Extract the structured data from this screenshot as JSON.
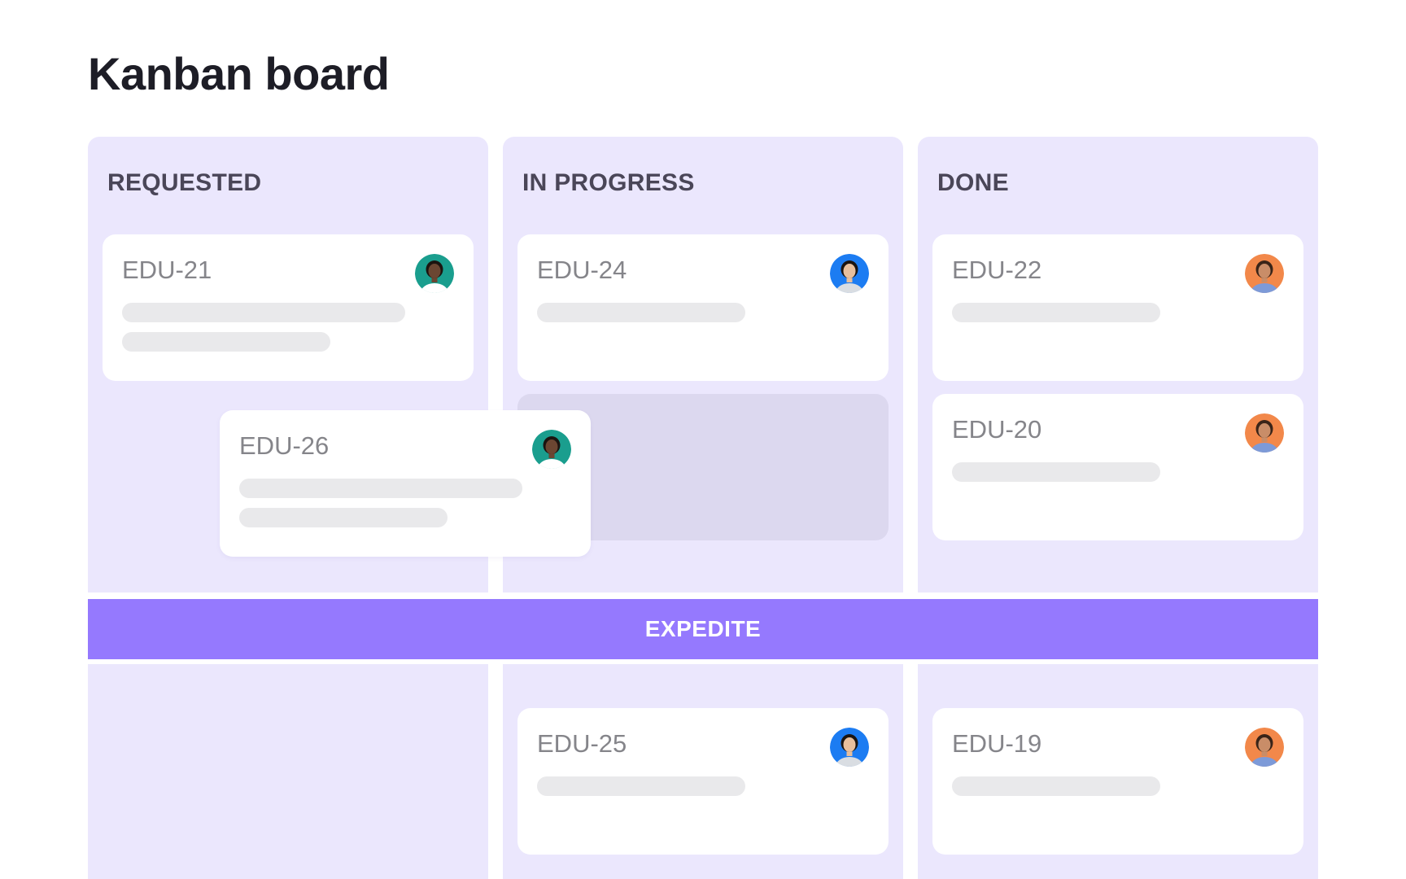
{
  "page": {
    "title": "Kanban board"
  },
  "columns": [
    {
      "id": "requested",
      "label": "REQUESTED"
    },
    {
      "id": "in_progress",
      "label": "IN PROGRESS"
    },
    {
      "id": "done",
      "label": "DONE"
    }
  ],
  "swimlane": {
    "label": "EXPEDITE"
  },
  "avatars": {
    "teal": {
      "bg": "#1a9e8e",
      "skin": "#6b4632",
      "hair": "#1b1410",
      "shirt": "#ffffff"
    },
    "blue": {
      "bg": "#1c7cf2",
      "skin": "#e7bf9d",
      "hair": "#1b1410",
      "shirt": "#d9dde2"
    },
    "orange": {
      "bg": "#f2884a",
      "skin": "#c98d68",
      "hair": "#3a2418",
      "shirt": "#7d9ad8"
    }
  },
  "cards": [
    {
      "id": "EDU-21",
      "column": "requested",
      "avatar": "teal",
      "lines": 2
    },
    {
      "id": "EDU-26",
      "column": "requested",
      "avatar": "teal",
      "lines": 2,
      "state": "dragging"
    },
    {
      "id": "EDU-24",
      "column": "in_progress",
      "avatar": "blue",
      "lines": 1
    },
    {
      "id": "EDU-22",
      "column": "done",
      "avatar": "orange",
      "lines": 1
    },
    {
      "id": "EDU-20",
      "column": "done",
      "avatar": "orange",
      "lines": 1
    },
    {
      "id": "EDU-25",
      "column": "in_progress",
      "lane": "expedite",
      "avatar": "blue",
      "lines": 1
    },
    {
      "id": "EDU-19",
      "column": "done",
      "lane": "expedite",
      "avatar": "orange",
      "lines": 1
    }
  ]
}
